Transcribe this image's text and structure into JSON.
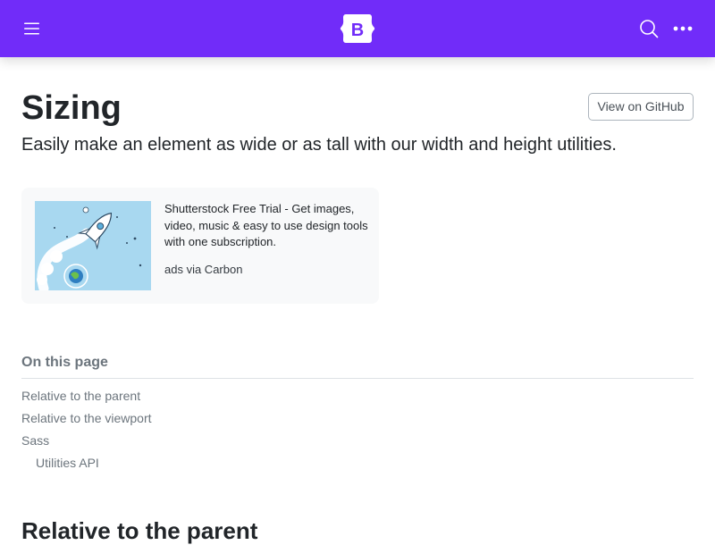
{
  "navbar": {
    "background": "#712cf9",
    "brand_letter": "B",
    "icons": [
      "hamburger-icon",
      "bootstrap-logo",
      "search-icon",
      "more-icon"
    ]
  },
  "page": {
    "title": "Sizing",
    "lead": "Easily make an element as wide or as tall with our width and height utilities.",
    "github_button": "View on GitHub"
  },
  "carbon_ad": {
    "text": "Shutterstock Free Trial - Get images, video, music & easy to use design tools with one subscription.",
    "powered_by": "ads via Carbon"
  },
  "toc": {
    "title": "On this page",
    "items": [
      {
        "label": "Relative to the parent"
      },
      {
        "label": "Relative to the viewport"
      },
      {
        "label": "Sass"
      },
      {
        "label": "Utilities API"
      }
    ]
  },
  "content": {
    "first_section_heading": "Relative to the parent"
  }
}
